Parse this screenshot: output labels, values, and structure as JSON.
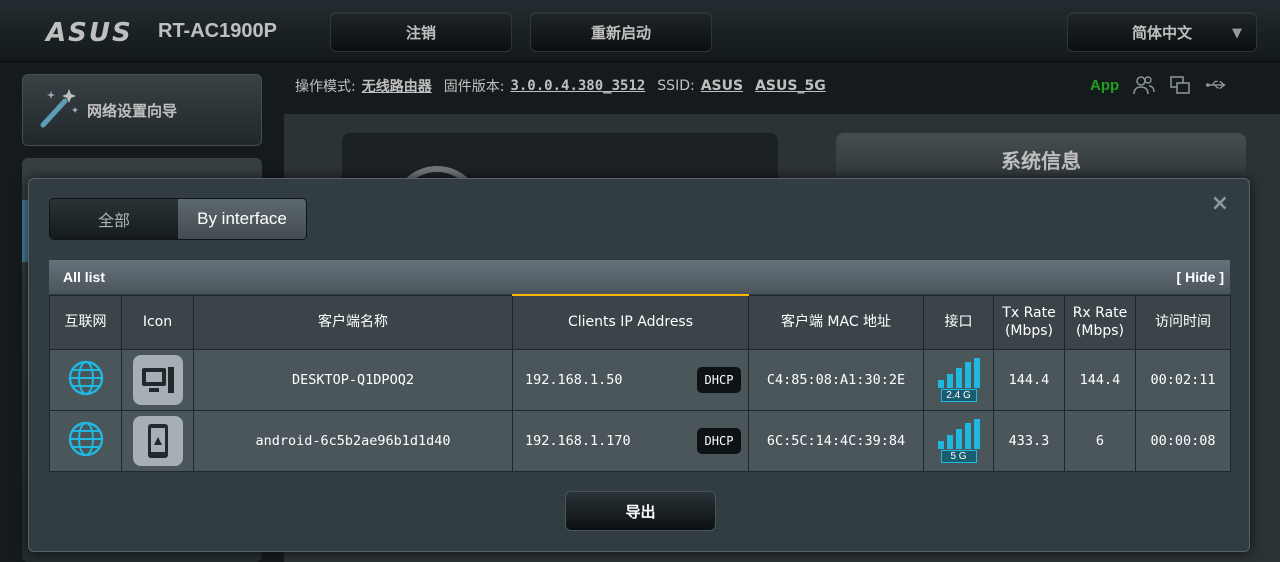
{
  "header": {
    "brand": "ASUS",
    "model": "RT-AC1900P",
    "logout_label": "注销",
    "reboot_label": "重新启动",
    "language_label": "简体中文"
  },
  "status": {
    "mode_label": "操作模式:",
    "mode_value": "无线路由器",
    "firmware_label": "固件版本:",
    "firmware_value": "3.0.0.4.380_3512",
    "ssid_label": "SSID:",
    "ssid_values": [
      "ASUS",
      "ASUS_5G"
    ],
    "app_label": "App",
    "icons": [
      "users-icon",
      "copy-icon",
      "usb-icon"
    ]
  },
  "sidebar": {
    "wizard_label": "网络设置向导",
    "wizard_icon": "magic-wand-icon"
  },
  "background": {
    "system_info_title": "系统信息"
  },
  "modal": {
    "segments": [
      "全部",
      "By interface"
    ],
    "active_segment": "By interface",
    "list_title": "All list",
    "hide_label": "[ Hide ]",
    "columns": [
      "互联网",
      "Icon",
      "客户端名称",
      "Clients IP Address",
      "客户端 MAC 地址",
      "接口",
      "Tx Rate\n(Mbps)",
      "Rx Rate\n(Mbps)",
      "访问时间"
    ],
    "sorted_column": "Clients IP Address",
    "rows": [
      {
        "internet_icon": "globe-icon",
        "device_icon": "desktop-icon",
        "name": "DESKTOP-Q1DPOQ2",
        "ip": "192.168.1.50",
        "ip_type": "DHCP",
        "mac": "C4:85:08:A1:30:2E",
        "band": "2.4 G",
        "tx": "144.4",
        "rx": "144.4",
        "time": "00:02:11"
      },
      {
        "internet_icon": "globe-icon",
        "device_icon": "phone-icon",
        "name": "android-6c5b2ae96b1d1d40",
        "ip": "192.168.1.170",
        "ip_type": "DHCP",
        "mac": "6C:5C:14:4C:39:84",
        "band": "5 G",
        "tx": "433.3",
        "rx": "6",
        "time": "00:00:08"
      }
    ],
    "export_label": "导出"
  },
  "colors": {
    "accent_cyan": "#1fb8e0",
    "app_green": "#2bd62b",
    "sort_indicator": "#ffb400"
  }
}
